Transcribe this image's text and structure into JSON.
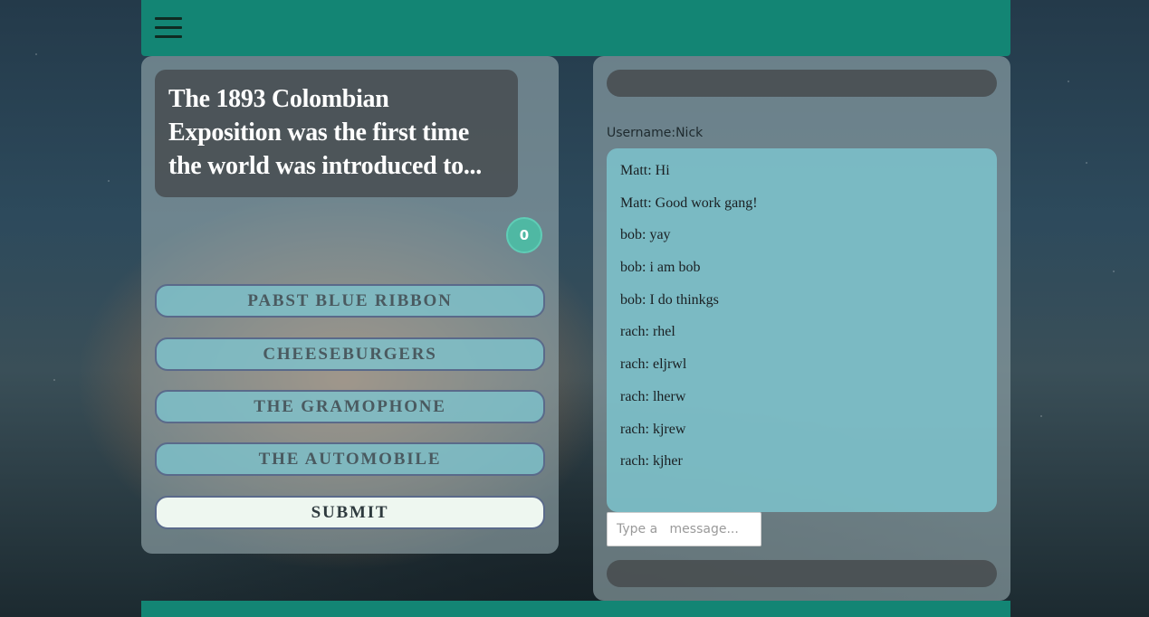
{
  "quiz": {
    "question": "The 1893 Colombian Exposition was the first time the world was introduced to...",
    "timer": "0",
    "answers": [
      "Pabst Blue Ribbon",
      "Cheeseburgers",
      "The Gramophone",
      "The Automobile"
    ],
    "submit_label": "SUBMIT"
  },
  "chat": {
    "username_label": "Username:Nick",
    "messages": [
      "Matt: Hi",
      "Matt: Good work gang!",
      "bob: yay",
      "bob: i am bob",
      "bob: I do thinkgs",
      "rach: rhel",
      "rach: eljrwl",
      "rach: lherw",
      "rach: kjrew",
      "rach: kjher"
    ],
    "input_placeholder": "Type a   message..."
  },
  "colors": {
    "header": "#138574",
    "timer": "#4fb8a3",
    "answer_bg": "#7dc3cd",
    "chat_bg": "#7dc3cd"
  },
  "icons": {
    "menu": "hamburger-menu-icon"
  }
}
